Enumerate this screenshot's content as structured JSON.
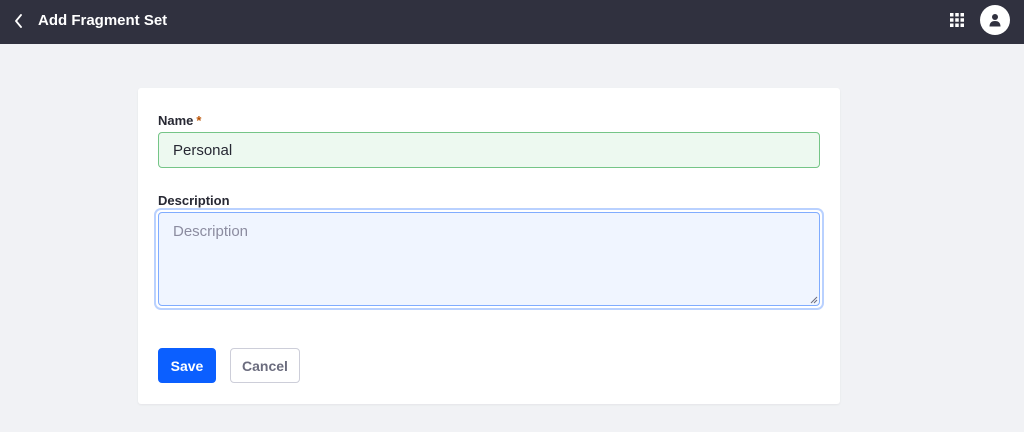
{
  "header": {
    "title": "Add Fragment Set",
    "back_icon": "chevron-left-icon",
    "apps_icon": "grid-menu-icon",
    "user_icon": "user-avatar-icon"
  },
  "form": {
    "name": {
      "label": "Name",
      "required_marker": "*",
      "value": "Personal"
    },
    "description": {
      "label": "Description",
      "placeholder": "Description",
      "value": ""
    },
    "actions": {
      "save_label": "Save",
      "cancel_label": "Cancel"
    }
  },
  "colors": {
    "topbar": "#30313f",
    "background": "#f1f2f5",
    "primary": "#0b5fff",
    "success_border": "#75c587",
    "focus_border": "#80acff"
  }
}
